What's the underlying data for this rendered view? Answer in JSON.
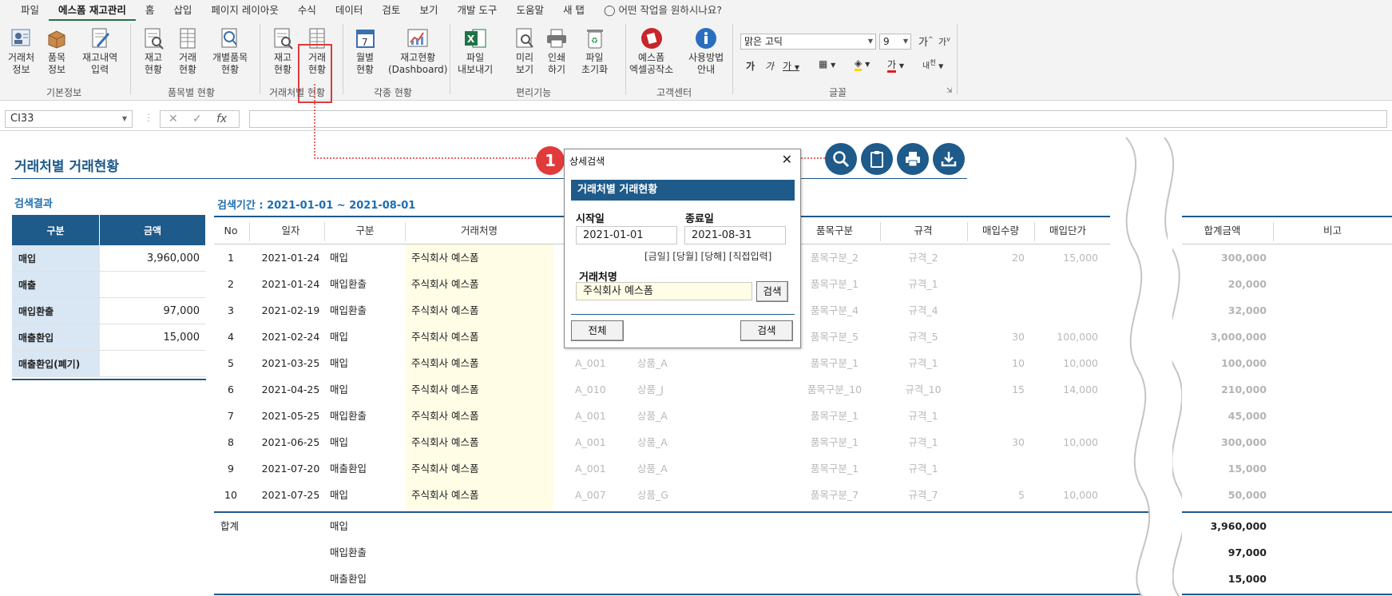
{
  "menu": [
    "파일",
    "에스폼 재고관리",
    "홈",
    "삽입",
    "페이지 레이아웃",
    "수식",
    "데이터",
    "검토",
    "보기",
    "개발 도구",
    "도움말",
    "새 탭",
    "어떤 작업을 원하시나요?"
  ],
  "ribbon": {
    "groups": {
      "basic": {
        "label": "기본정보",
        "buttons": [
          {
            "l1": "거래처",
            "l2": "정보"
          },
          {
            "l1": "품목",
            "l2": "정보"
          },
          {
            "l1": "재고내역",
            "l2": "입력"
          }
        ]
      },
      "item": {
        "label": "품목별 현황",
        "buttons": [
          {
            "l1": "재고",
            "l2": "현황"
          },
          {
            "l1": "거래",
            "l2": "현황"
          },
          {
            "l1": "개별품목",
            "l2": "현황"
          }
        ]
      },
      "partner": {
        "label": "거래처별 현황",
        "buttons": [
          {
            "l1": "재고",
            "l2": "현황"
          },
          {
            "l1": "거래",
            "l2": "현황"
          }
        ]
      },
      "various": {
        "label": "각종 현황",
        "buttons": [
          {
            "l1": "월별",
            "l2": "현황"
          },
          {
            "l1": "재고현황",
            "l2": "(Dashboard)"
          }
        ]
      },
      "util": {
        "label": "편리기능",
        "buttons": [
          {
            "l1": "파일",
            "l2": "내보내기"
          },
          {
            "l1": "미리",
            "l2": "보기"
          },
          {
            "l1": "인쇄",
            "l2": "하기"
          },
          {
            "l1": "파일",
            "l2": "초기화"
          }
        ]
      },
      "support": {
        "label": "고객센터",
        "buttons": [
          {
            "l1": "예스폼",
            "l2": "엑셀공작소"
          },
          {
            "l1": "사용방법",
            "l2": "안내"
          }
        ]
      },
      "font": {
        "label": "글꼴",
        "font_name": "맑은 고딕",
        "font_size": "9"
      }
    }
  },
  "formula_bar": {
    "name_box": "CI33",
    "fx": "fx"
  },
  "sheet": {
    "title": "거래처별 거래현황",
    "summary_label": "검색결과",
    "period": "검색기간 : 2021-01-01 ~ 2021-08-01",
    "summary": {
      "headers": [
        "구분",
        "금액"
      ],
      "rows": [
        {
          "k": "매입",
          "v": "3,960,000"
        },
        {
          "k": "매출",
          "v": ""
        },
        {
          "k": "매입환출",
          "v": "97,000"
        },
        {
          "k": "매출환입",
          "v": "15,000"
        },
        {
          "k": "매출환입(폐기)",
          "v": ""
        }
      ]
    },
    "table": {
      "headers": [
        "No",
        "일자",
        "구분",
        "거래처명",
        "품목구분",
        "규격",
        "매입수량",
        "매입단가",
        "합계금액",
        "비고"
      ],
      "rows": [
        {
          "no": "1",
          "date": "2021-01-24",
          "type": "매입",
          "partner": "주식회사 예스폼",
          "code": "",
          "item": "",
          "cat": "품목구분_2",
          "spec": "규격_2",
          "qty": "20",
          "price": "15,000",
          "total": "300,000"
        },
        {
          "no": "2",
          "date": "2021-01-24",
          "type": "매입환출",
          "partner": "주식회사 예스폼",
          "code": "",
          "item": "",
          "cat": "품목구분_1",
          "spec": "규격_1",
          "qty": "",
          "price": "",
          "total": "20,000"
        },
        {
          "no": "3",
          "date": "2021-02-19",
          "type": "매입환출",
          "partner": "주식회사 예스폼",
          "code": "",
          "item": "",
          "cat": "품목구분_4",
          "spec": "규격_4",
          "qty": "",
          "price": "",
          "total": "32,000"
        },
        {
          "no": "4",
          "date": "2021-02-24",
          "type": "매입",
          "partner": "주식회사 예스폼",
          "code": "",
          "item": "",
          "cat": "품목구분_5",
          "spec": "규격_5",
          "qty": "30",
          "price": "100,000",
          "total": "3,000,000"
        },
        {
          "no": "5",
          "date": "2021-03-25",
          "type": "매입",
          "partner": "주식회사 예스폼",
          "code": "A_001",
          "item": "상품_A",
          "cat": "품목구분_1",
          "spec": "규격_1",
          "qty": "10",
          "price": "10,000",
          "total": "100,000"
        },
        {
          "no": "6",
          "date": "2021-04-25",
          "type": "매입",
          "partner": "주식회사 예스폼",
          "code": "A_010",
          "item": "상품_J",
          "cat": "품목구분_10",
          "spec": "규격_10",
          "qty": "15",
          "price": "14,000",
          "total": "210,000"
        },
        {
          "no": "7",
          "date": "2021-05-25",
          "type": "매입환출",
          "partner": "주식회사 예스폼",
          "code": "A_001",
          "item": "상품_A",
          "cat": "품목구분_1",
          "spec": "규격_1",
          "qty": "",
          "price": "",
          "total": "45,000"
        },
        {
          "no": "8",
          "date": "2021-06-25",
          "type": "매입",
          "partner": "주식회사 예스폼",
          "code": "A_001",
          "item": "상품_A",
          "cat": "품목구분_1",
          "spec": "규격_1",
          "qty": "30",
          "price": "10,000",
          "total": "300,000"
        },
        {
          "no": "9",
          "date": "2021-07-20",
          "type": "매출환입",
          "partner": "주식회사 예스폼",
          "code": "A_001",
          "item": "상품_A",
          "cat": "품목구분_1",
          "spec": "규격_1",
          "qty": "",
          "price": "",
          "total": "15,000"
        },
        {
          "no": "10",
          "date": "2021-07-25",
          "type": "매입",
          "partner": "주식회사 예스폼",
          "code": "A_007",
          "item": "상품_G",
          "cat": "품목구분_7",
          "spec": "규격_7",
          "qty": "5",
          "price": "10,000",
          "total": "50,000"
        }
      ],
      "totals_label": "합계",
      "totals": [
        {
          "type": "매입",
          "total": "3,960,000"
        },
        {
          "type": "매입환출",
          "total": "97,000"
        },
        {
          "type": "매출환입",
          "total": "15,000"
        }
      ]
    }
  },
  "dialog": {
    "title": "상세검색",
    "bar": "거래처별 거래현황",
    "start_label": "시작일",
    "end_label": "종료일",
    "start": "2021-01-01",
    "end": "2021-08-31",
    "links": "[금일]  [당월]  [당해]  [직접입력]",
    "partner_label": "거래처명",
    "partner_value": "주식회사 예스폼",
    "search_small": "검색",
    "all_button": "전체",
    "search_button": "검색"
  },
  "badge": "1",
  "colors": {
    "accent": "#1e5a8a",
    "highlight": "#e03a3a",
    "excel_green": "#217346",
    "yellow_cell": "#fffde6"
  }
}
